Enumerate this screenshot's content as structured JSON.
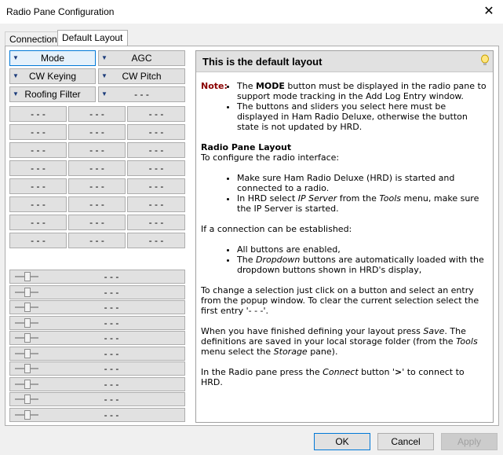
{
  "window": {
    "title": "Radio Pane Configuration",
    "close_glyph": "✕"
  },
  "tabs": [
    {
      "label": "Connection"
    },
    {
      "label": "Default Layout"
    }
  ],
  "dropdown_buttons": [
    {
      "label": "Mode"
    },
    {
      "label": "AGC"
    },
    {
      "label": "CW Keying"
    },
    {
      "label": "CW Pitch"
    },
    {
      "label": "Roofing Filter"
    },
    {
      "label": "- - -"
    }
  ],
  "grid_button_label": "- - -",
  "slider_label": "- - -",
  "help": {
    "heading": "This is the default layout",
    "note_label": "Note:",
    "note_items": [
      [
        "The ",
        "MODE",
        " button must be displayed in the radio pane to support mode tracking in the Add Log Entry window."
      ],
      "The buttons and sliders you select here must be displayed in Ham Radio Deluxe, otherwise the button state is not updated by HRD."
    ],
    "layout_title": "Radio Pane Layout",
    "layout_intro": "To configure the radio interface:",
    "layout_items": [
      "Make sure Ham Radio Deluxe (HRD) is started and connected to a radio.",
      [
        "In HRD select ",
        "IP Server",
        " from the ",
        "Tools",
        " menu, make sure the IP Server is started."
      ]
    ],
    "conn_intro": "If a connection can be established:",
    "conn_items": [
      "All buttons are enabled,",
      [
        "The ",
        "Dropdown",
        " buttons are automatically loaded with the dropdown buttons shown in HRD's display,"
      ]
    ],
    "change_text": "To change a selection just click on a button and select an entry from the popup window. To clear the current selection select the first entry '- - -'.",
    "save_text": [
      "When you have finished defining your layout press ",
      "Save",
      ". The definitions are saved in your local storage folder (from the ",
      "Tools",
      " menu select the ",
      "Storage",
      " pane)."
    ],
    "connect_text": [
      "In the Radio pane press the ",
      "Connect",
      " button '",
      ">",
      "' to connect to HRD."
    ]
  },
  "footer": {
    "ok": "OK",
    "cancel": "Cancel",
    "apply": "Apply"
  },
  "colors": {
    "accent": "#0078d7",
    "note": "#8b0000",
    "panel_header": "#e1e1e1"
  }
}
